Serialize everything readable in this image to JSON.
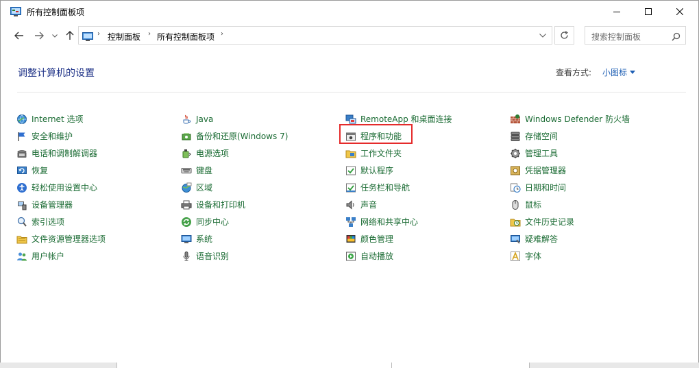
{
  "window": {
    "title": "所有控制面板项"
  },
  "address": {
    "crumbs": [
      "控制面板",
      "所有控制面板项"
    ]
  },
  "search": {
    "placeholder": "搜索控制面板"
  },
  "header": {
    "heading": "调整计算机的设置",
    "view_by_label": "查看方式:",
    "view_by_value": "小图标"
  },
  "colors": {
    "link_green": "#1a6b33",
    "heading_blue": "#1e3287",
    "highlight_red": "#e52b2b"
  },
  "columns": [
    [
      {
        "label": "Internet 选项",
        "icon": "globe-icon"
      },
      {
        "label": "安全和维护",
        "icon": "flag-icon"
      },
      {
        "label": "电话和调制解调器",
        "icon": "phone-icon"
      },
      {
        "label": "恢复",
        "icon": "recovery-icon"
      },
      {
        "label": "轻松使用设置中心",
        "icon": "accessibility-icon"
      },
      {
        "label": "设备管理器",
        "icon": "device-manager-icon"
      },
      {
        "label": "索引选项",
        "icon": "index-icon"
      },
      {
        "label": "文件资源管理器选项",
        "icon": "folder-options-icon"
      },
      {
        "label": "用户帐户",
        "icon": "users-icon"
      }
    ],
    [
      {
        "label": "Java",
        "icon": "java-icon"
      },
      {
        "label": "备份和还原(Windows 7)",
        "icon": "backup-icon"
      },
      {
        "label": "电源选项",
        "icon": "power-icon"
      },
      {
        "label": "键盘",
        "icon": "keyboard-icon"
      },
      {
        "label": "区域",
        "icon": "region-icon"
      },
      {
        "label": "设备和打印机",
        "icon": "printer-icon"
      },
      {
        "label": "同步中心",
        "icon": "sync-icon"
      },
      {
        "label": "系统",
        "icon": "system-icon"
      },
      {
        "label": "语音识别",
        "icon": "microphone-icon"
      }
    ],
    [
      {
        "label": "RemoteApp 和桌面连接",
        "icon": "remoteapp-icon"
      },
      {
        "label": "程序和功能",
        "icon": "programs-icon"
      },
      {
        "label": "工作文件夹",
        "icon": "work-folders-icon"
      },
      {
        "label": "默认程序",
        "icon": "default-programs-icon"
      },
      {
        "label": "任务栏和导航",
        "icon": "taskbar-icon"
      },
      {
        "label": "声音",
        "icon": "speaker-icon"
      },
      {
        "label": "网络和共享中心",
        "icon": "network-icon"
      },
      {
        "label": "颜色管理",
        "icon": "color-icon"
      },
      {
        "label": "自动播放",
        "icon": "autoplay-icon"
      }
    ],
    [
      {
        "label": "Windows Defender 防火墙",
        "icon": "firewall-icon"
      },
      {
        "label": "存储空间",
        "icon": "storage-icon"
      },
      {
        "label": "管理工具",
        "icon": "admin-tools-icon"
      },
      {
        "label": "凭据管理器",
        "icon": "credential-icon"
      },
      {
        "label": "日期和时间",
        "icon": "clock-icon"
      },
      {
        "label": "鼠标",
        "icon": "mouse-icon"
      },
      {
        "label": "文件历史记录",
        "icon": "file-history-icon"
      },
      {
        "label": "疑难解答",
        "icon": "troubleshoot-icon"
      },
      {
        "label": "字体",
        "icon": "font-icon"
      }
    ]
  ]
}
